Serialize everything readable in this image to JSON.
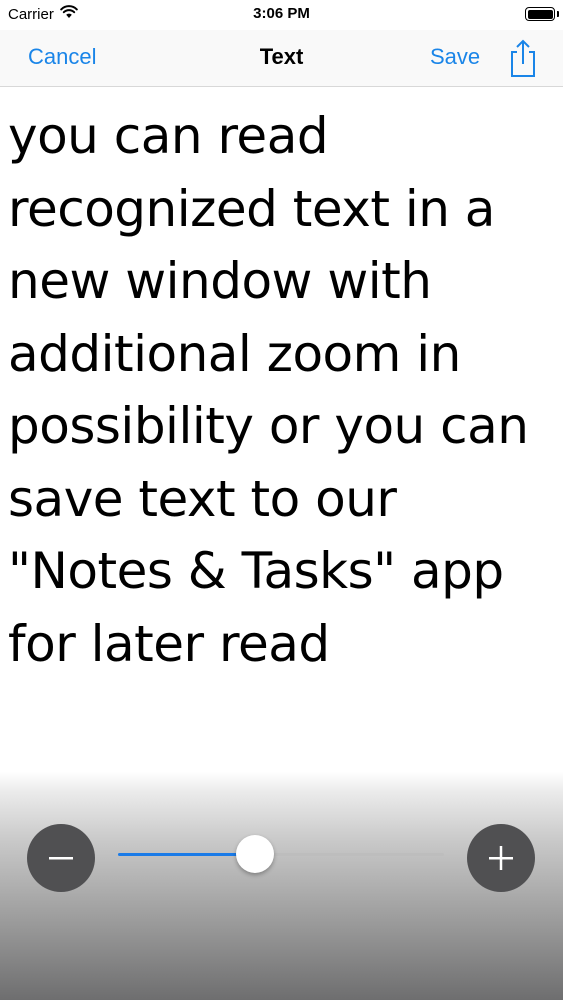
{
  "status_bar": {
    "carrier": "Carrier",
    "time": "3:06 PM",
    "wifi_icon": "wifi-icon",
    "battery_icon": "battery-full-icon"
  },
  "nav": {
    "cancel_label": "Cancel",
    "title": "Text",
    "save_label": "Save",
    "share_icon": "share-icon"
  },
  "content": {
    "text": "you can read\nrecognized text in a\nnew window with\nadditional zoom in\npossibility or you can\nsave text to our\n\"Notes & Tasks\" app\nfor later read"
  },
  "zoom": {
    "zoom_out_icon": "minus-icon",
    "zoom_in_icon": "plus-icon",
    "slider_value": 0.42
  },
  "colors": {
    "accent": "#1a85e8",
    "slider_fill": "#1a7be8",
    "zoom_button": "#505052"
  }
}
